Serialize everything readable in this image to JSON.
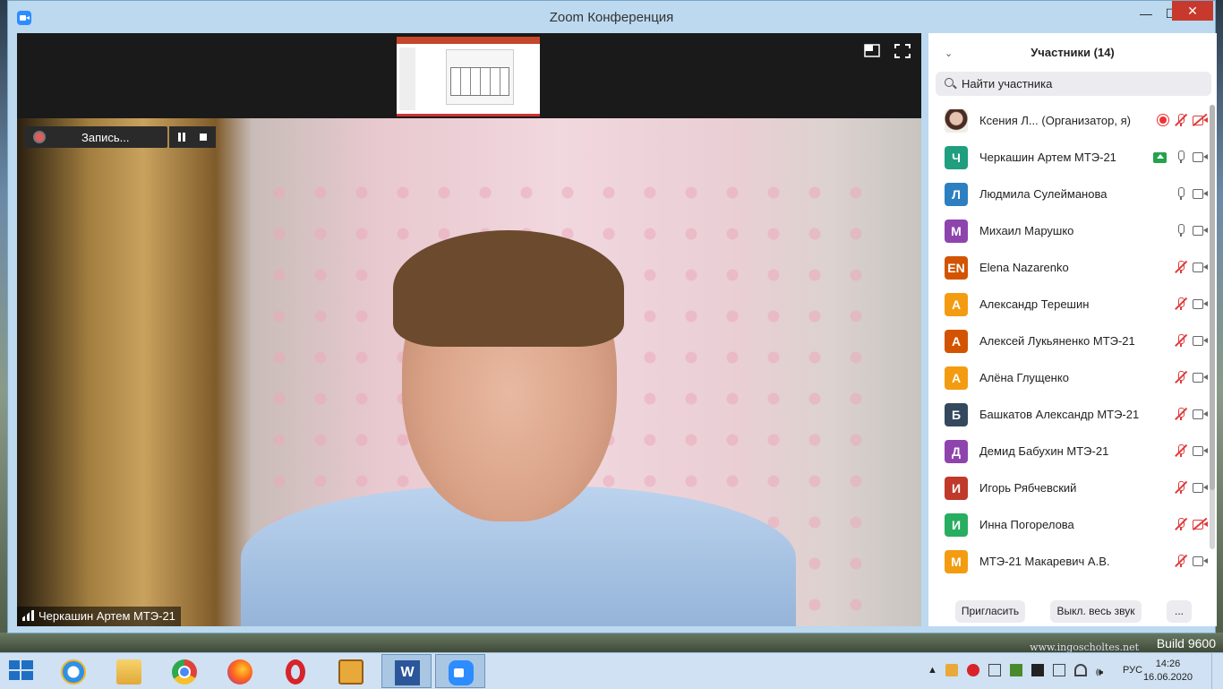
{
  "window": {
    "title": "Zoom Конференция",
    "minimize": "—",
    "maximize": "☐",
    "close": "✕"
  },
  "video": {
    "recording_label": "Запись...",
    "speaker_name": "Черкашин Артем МТЭ-21"
  },
  "participants": {
    "header": "Участники (14)",
    "search_placeholder": "Найти участника",
    "list": [
      {
        "name": "Ксения Л...  (Организатор, я)",
        "initial": "",
        "color": "photo",
        "mic": "muted",
        "cam": "off",
        "status": "recording"
      },
      {
        "name": "Черкашин Артем МТЭ-21",
        "initial": "Ч",
        "color": "#1f9e80",
        "mic": "on",
        "cam": "on",
        "status": "sharing"
      },
      {
        "name": "Людмила Сулейманова",
        "initial": "Л",
        "color": "#2d7fc1",
        "mic": "on",
        "cam": "on",
        "status": ""
      },
      {
        "name": "Михаил Марушко",
        "initial": "М",
        "color": "#8e44ad",
        "mic": "on",
        "cam": "on",
        "status": ""
      },
      {
        "name": "Elena Nazarenko",
        "initial": "EN",
        "color": "#d35400",
        "mic": "muted",
        "cam": "on",
        "status": ""
      },
      {
        "name": "Александр Терешин",
        "initial": "А",
        "color": "#f39c12",
        "mic": "muted",
        "cam": "on",
        "status": ""
      },
      {
        "name": "Алексей Лукьяненко МТЭ-21",
        "initial": "А",
        "color": "#d35400",
        "mic": "muted",
        "cam": "on",
        "status": ""
      },
      {
        "name": "Алёна Глущенко",
        "initial": "А",
        "color": "#f39c12",
        "mic": "muted",
        "cam": "on",
        "status": ""
      },
      {
        "name": "Башкатов Александр МТЭ-21",
        "initial": "Б",
        "color": "#34495e",
        "mic": "muted",
        "cam": "on",
        "status": ""
      },
      {
        "name": "Демид Бабухин МТЭ-21",
        "initial": "Д",
        "color": "#8e44ad",
        "mic": "muted",
        "cam": "on",
        "status": ""
      },
      {
        "name": "Игорь Рябчевский",
        "initial": "И",
        "color": "#c0392b",
        "mic": "muted",
        "cam": "on",
        "status": ""
      },
      {
        "name": "Инна Погорелова",
        "initial": "И",
        "color": "#27ae60",
        "mic": "muted",
        "cam": "off",
        "status": ""
      },
      {
        "name": "МТЭ-21 Макаревич А.В.",
        "initial": "М",
        "color": "#f39c12",
        "mic": "muted",
        "cam": "on",
        "status": ""
      }
    ],
    "invite_label": "Пригласить",
    "mute_all_label": "Выкл. весь звук",
    "more_label": "..."
  },
  "desktop": {
    "watermark": "www.ingoscholtes.net",
    "build": "Build 9600"
  },
  "taskbar": {
    "word_letter": "W",
    "language": "РУС",
    "time": "14:26",
    "date": "16.06.2020"
  }
}
